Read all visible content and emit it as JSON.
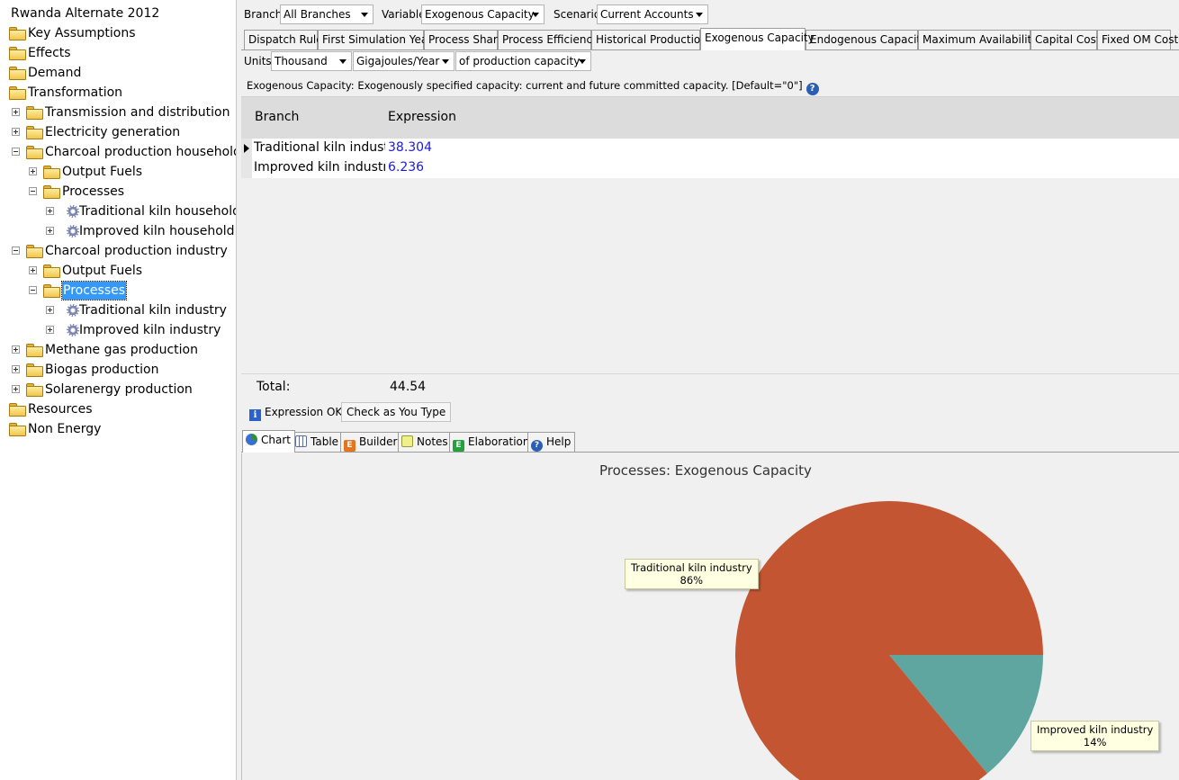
{
  "tree": {
    "root": "Rwanda Alternate 2012",
    "items": [
      "Key Assumptions",
      "Effects",
      "Demand",
      "Transformation",
      "Transmission and distribution",
      "Electricity generation",
      "Charcoal production household",
      "Output Fuels",
      "Processes",
      "Traditional kiln household",
      "Improved kiln household",
      "Charcoal production industry",
      "Output Fuels",
      "Processes",
      "Traditional kiln industry",
      "Improved kiln industry",
      "Methane gas production",
      "Biogas production",
      "Solarenergy production",
      "Resources",
      "Non Energy"
    ]
  },
  "toolbar": {
    "branch_label": "Branch:",
    "branch_value": "All Branches",
    "variable_label": "Variable:",
    "variable_value": "Exogenous Capacity",
    "scenario_label": "Scenario:",
    "scenario_value": "Current Accounts"
  },
  "variable_tabs": [
    "Dispatch Rule",
    "First Simulation Year",
    "Process Share",
    "Process Efficiency",
    "Historical Production",
    "Exogenous Capacity",
    "Endogenous Capacity",
    "Maximum Availability",
    "Capital Cost",
    "Fixed OM Cost"
  ],
  "units": {
    "label": "Units:",
    "scale": "Thousand",
    "unit": "Gigajoules/Year",
    "qualifier": "of production capacity"
  },
  "description": "Exogenous Capacity: Exogenously specified capacity: current and future committed capacity. [Default=\"0\"]",
  "grid": {
    "col_branch": "Branch",
    "col_expression": "Expression",
    "rows": [
      {
        "branch": "Traditional kiln industry",
        "expression": "38.304"
      },
      {
        "branch": "Improved kiln industry",
        "expression": "6.236"
      }
    ],
    "total_label": "Total:",
    "total_value": "44.54"
  },
  "status": {
    "expression_ok": "Expression OK",
    "check_as_you_type": "Check as You Type"
  },
  "bottom_tabs": [
    "Chart",
    "Table",
    "Builder",
    "Notes",
    "Elaboration",
    "Help"
  ],
  "chart_data": {
    "type": "pie",
    "title": "Processes: Exogenous Capacity",
    "slices": [
      {
        "label": "Traditional kiln industry",
        "value": 38.304,
        "percent_label": "86%",
        "color": "#c45532"
      },
      {
        "label": "Improved kiln industry",
        "value": 6.236,
        "percent_label": "14%",
        "color": "#5fa5a0"
      }
    ]
  }
}
